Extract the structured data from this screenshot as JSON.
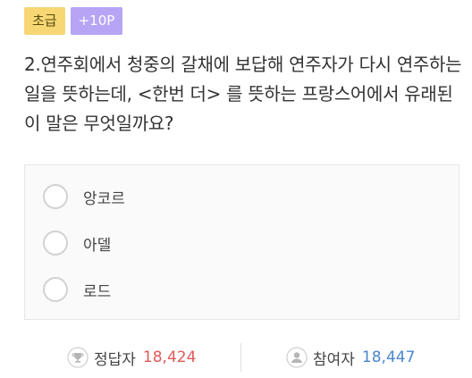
{
  "badges": {
    "level": "초급",
    "points": "+10P"
  },
  "question": {
    "text": "2.연주회에서 청중의 갈채에 보답해 연주자가 다시 연주하는 일을 뜻하는데, <한번 더> 를 뜻하는 프랑스어에서 유래된 이 말은 무엇일까요?"
  },
  "options": [
    {
      "label": "앙코르",
      "selected": false
    },
    {
      "label": "아델",
      "selected": false
    },
    {
      "label": "로드",
      "selected": false
    }
  ],
  "stats": {
    "correct_label": "정답자",
    "correct_count": "18,424",
    "participants_label": "참여자",
    "participants_count": "18,447"
  },
  "colors": {
    "level_badge": "#f7d774",
    "points_badge": "#b7a4f5",
    "correct_count": "#e05a5a",
    "participants_count": "#4a86cf"
  },
  "icons": {
    "correct": "trophy-icon",
    "participants": "person-icon"
  }
}
